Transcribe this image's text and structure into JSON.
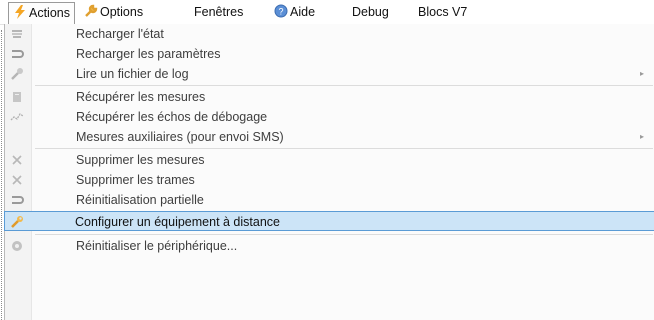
{
  "menubar": {
    "items": [
      {
        "label": "Actions",
        "icon": "lightning-icon"
      },
      {
        "label": "Options",
        "icon": "wrench-icon"
      },
      {
        "label": "Fenêtres"
      },
      {
        "label": "Aide",
        "icon": "help-globe-icon"
      },
      {
        "label": "Debug"
      },
      {
        "label": "Blocs V7"
      }
    ]
  },
  "menu": {
    "items": [
      {
        "label": "Recharger l'état",
        "icon": "reload-state-icon"
      },
      {
        "label": "Recharger les paramètres",
        "icon": "reload-params-icon"
      },
      {
        "label": "Lire un fichier de log",
        "icon": "wrench-gray-icon",
        "submenu": "▸"
      },
      {
        "label": "Récupérer les mesures",
        "icon": "retrieve-measures-icon"
      },
      {
        "label": "Récupérer les échos de débogage",
        "icon": "debug-echo-icon"
      },
      {
        "label": "Mesures auxiliaires (pour envoi SMS)",
        "submenu": "▸"
      },
      {
        "label": "Supprimer les mesures",
        "icon": "delete-x-icon"
      },
      {
        "label": "Supprimer les trames",
        "icon": "delete-x-icon"
      },
      {
        "label": "Réinitialisation partielle",
        "icon": "partial-reset-icon"
      },
      {
        "label": "Configurer un équipement à distance",
        "icon": "wrench-icon"
      },
      {
        "label": "Réinitialiser le périphérique...",
        "icon": "reset-device-icon"
      }
    ]
  },
  "colors": {
    "accent_orange": "#f5a623",
    "highlight_bg": "#cce4f7",
    "highlight_border": "#5a9bd5"
  }
}
